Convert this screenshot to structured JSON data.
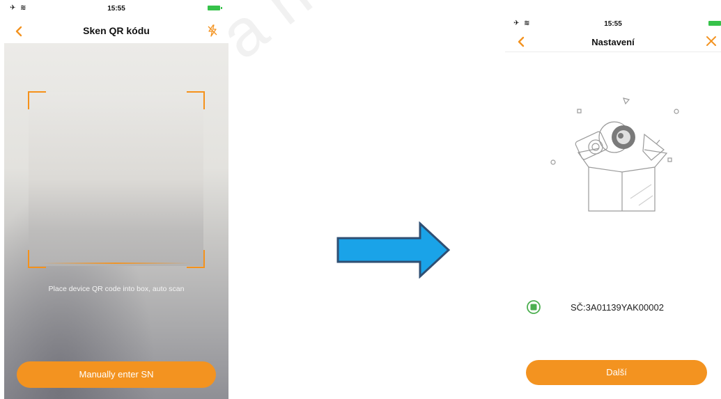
{
  "left_screen": {
    "status": {
      "time": "15:55",
      "left_icons": "✈ ≋"
    },
    "nav": {
      "title": "Sken QR kódu"
    },
    "hint": "Place device QR code into box, auto scan",
    "manual_button": "Manually enter SN",
    "icons": [
      "back-icon",
      "flash-icon"
    ]
  },
  "right_screen": {
    "status": {
      "time": "15:55",
      "left_icons": "✈ ≋"
    },
    "nav": {
      "title": "Nastavení"
    },
    "sn_label": "SČ:3A01139YAK00002",
    "next_button": "Další",
    "icons": [
      "back-icon",
      "close-icon",
      "device-box-icon"
    ]
  },
  "watermark": "a hua",
  "colors": {
    "accent": "#f39320",
    "arrow_fill": "#1aa3e8",
    "arrow_stroke": "#2f4f73",
    "battery": "#36c24a",
    "sn_icon": "#4caf50"
  }
}
